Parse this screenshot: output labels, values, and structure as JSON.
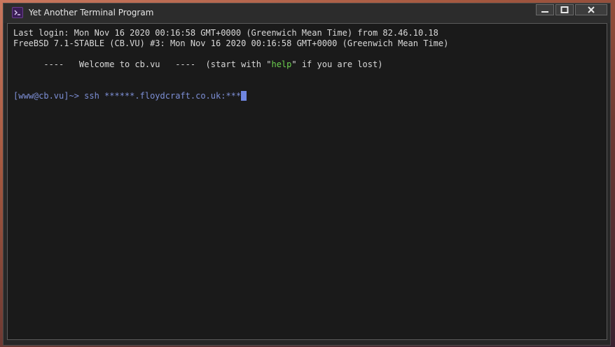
{
  "window": {
    "title": "Yet Another Terminal Program",
    "icon": "terminal-app-icon",
    "controls": [
      "minimize-icon",
      "maximize-icon",
      "close-icon"
    ]
  },
  "terminal": {
    "lines": {
      "last_login": "Last login: Mon Nov 16 2020 00:16:58 GMT+0000 (Greenwich Mean Time) from 82.46.10.18",
      "system": "FreeBSD 7.1-STABLE (CB.VU) #3: Mon Nov 16 2020 00:16:58 GMT+0000 (Greenwich Mean Time)",
      "welcome_prefix": "      ----   Welcome to cb.vu   ----  (start with \"",
      "welcome_help": "help",
      "welcome_suffix": "\" if you are lost)",
      "prompt": "[www@cb.vu]~> ",
      "command": "ssh ******.floydcraft.co.uk:***"
    }
  },
  "colors": {
    "background": "#1a1a1a",
    "text": "#d9d9d9",
    "prompt": "#7d8fd6",
    "help_highlight": "#6cd14f",
    "cursor": "#6f86e0"
  }
}
